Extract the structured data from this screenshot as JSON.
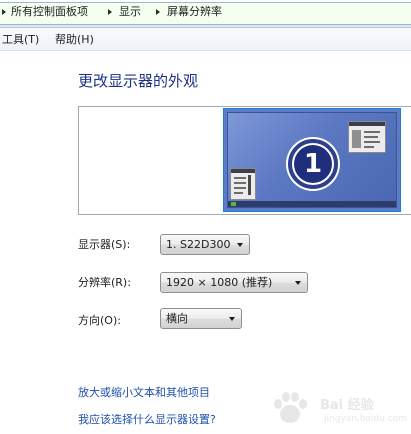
{
  "address_bar": {
    "crumbs": [
      "所有控制面板项",
      "显示",
      "屏幕分辨率"
    ]
  },
  "menu": {
    "tools": "工具(T)",
    "help": "帮助(H)"
  },
  "page": {
    "title": "更改显示器的外观"
  },
  "monitor_preview": {
    "number": "1"
  },
  "settings": {
    "display_label": "显示器(S):",
    "display_value": "1. S22D300",
    "resolution_label": "分辨率(R):",
    "resolution_value": "1920 × 1080 (推荐)",
    "orientation_label": "方向(O):",
    "orientation_value": "横向"
  },
  "links": {
    "text_size": "放大或缩小文本和其他项目",
    "which_settings": "我应该选择什么显示器设置?"
  },
  "watermark": {
    "brand": "Bai 经验",
    "url": "jingyan.baidu.com"
  },
  "colors": {
    "title": "#1e3287",
    "link": "#1e4fae",
    "monitor_blue": "#5c7cc8",
    "badge_navy": "#1f2f7d",
    "address_green": "#f4fff0"
  }
}
